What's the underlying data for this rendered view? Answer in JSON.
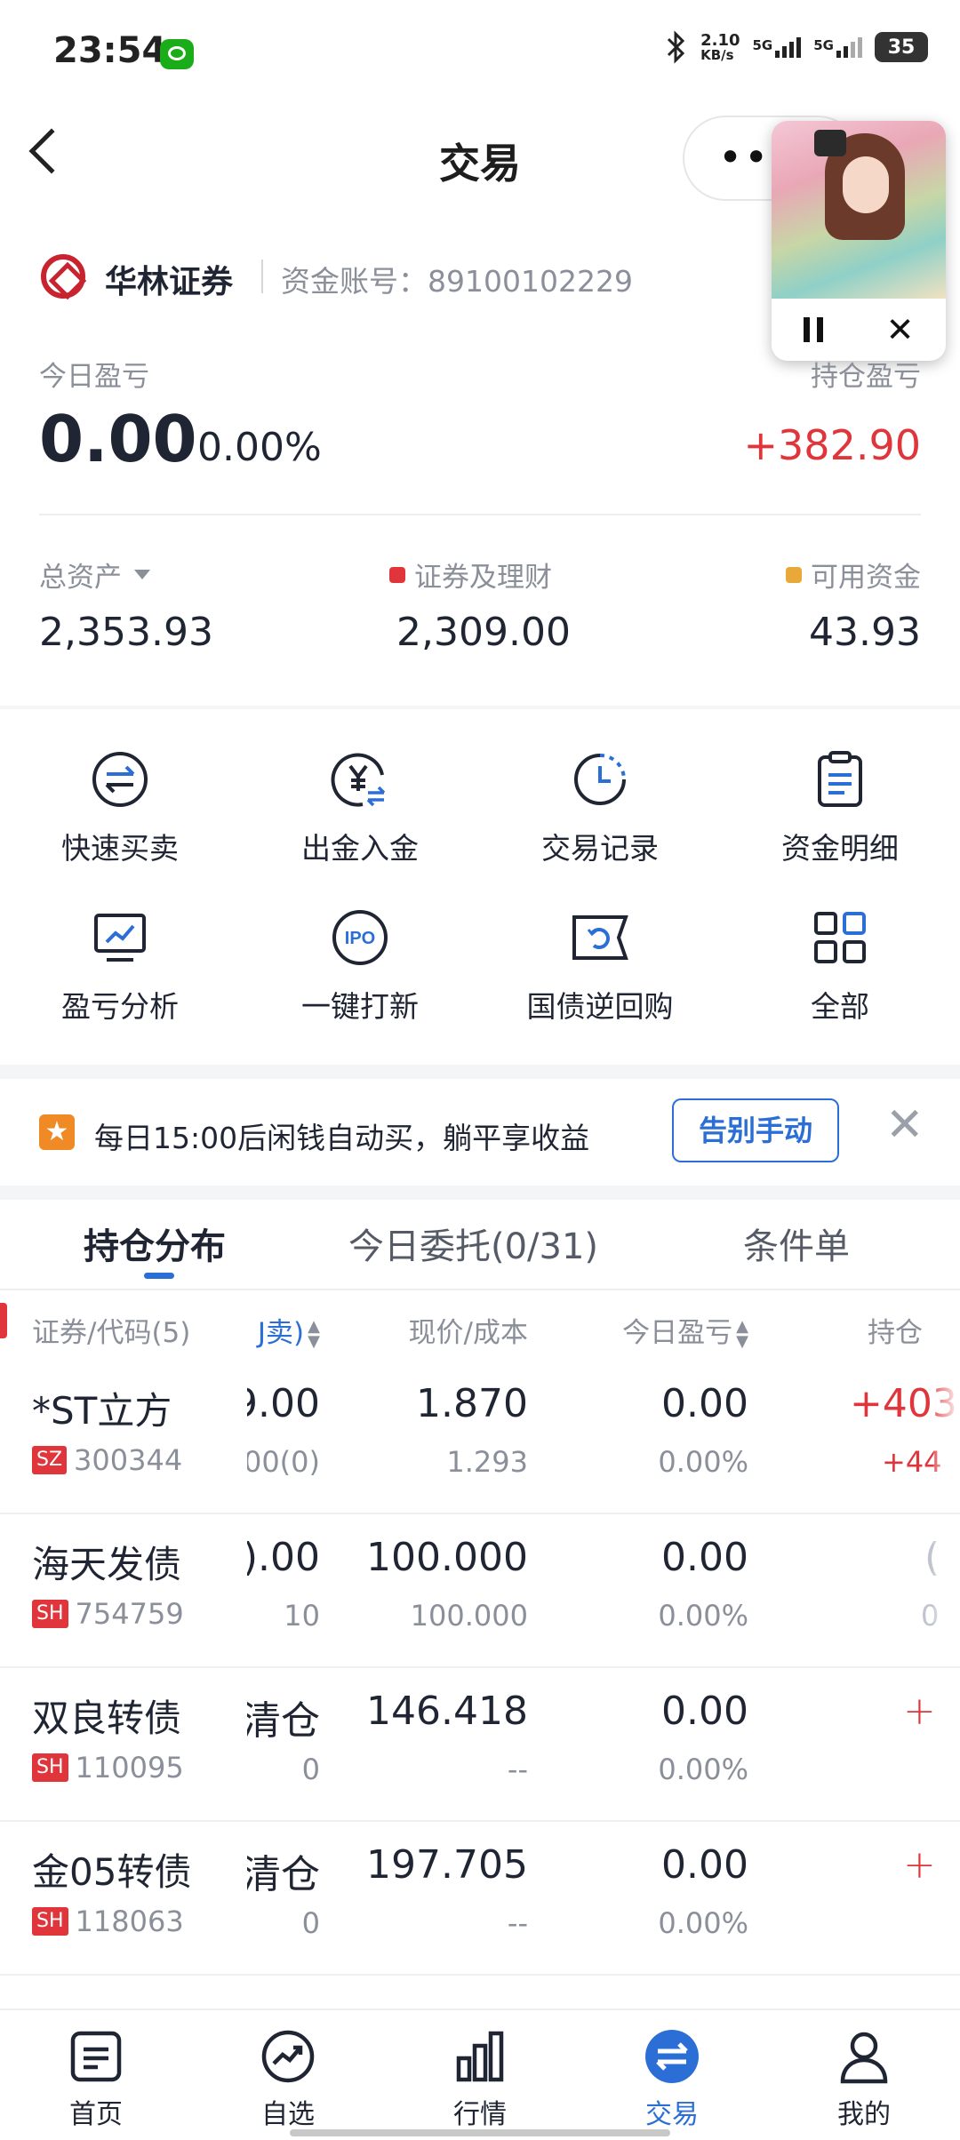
{
  "status_bar": {
    "time": "23:54",
    "net_speed": "2.10",
    "net_unit": "KB/s",
    "sig1": "5G",
    "sig2": "5G",
    "battery": "35"
  },
  "header": {
    "title": "交易"
  },
  "broker": {
    "name": "华林证券",
    "account": "资金账号：89100102229"
  },
  "pnl": {
    "today_label": "今日盈亏",
    "today_value": "0.00",
    "today_pct": "0.00%",
    "hold_label": "持仓盈亏",
    "hold_value": "+382.90"
  },
  "assets": {
    "total_label": "总资产",
    "total_value": "2,353.93",
    "securities_label": "证券及理财",
    "securities_value": "2,309.00",
    "available_label": "可用资金",
    "available_value": "43.93"
  },
  "quick_actions": [
    {
      "label": "快速买卖",
      "icon": "swap-icon"
    },
    {
      "label": "出金入金",
      "icon": "yuan-transfer-icon"
    },
    {
      "label": "交易记录",
      "icon": "clock-icon"
    },
    {
      "label": "资金明细",
      "icon": "clipboard-icon"
    },
    {
      "label": "盈亏分析",
      "icon": "chart-monitor-icon"
    },
    {
      "label": "一键打新",
      "icon": "ipo-icon"
    },
    {
      "label": "国债逆回购",
      "icon": "ticket-icon"
    },
    {
      "label": "全部",
      "icon": "grid-icon"
    }
  ],
  "promo": {
    "text": "每日15:00后闲钱自动买，躺平享收益",
    "button": "告别手动"
  },
  "tabs": [
    "持仓分布",
    "今日委托(0/31)",
    "条件单"
  ],
  "table": {
    "headers": [
      "证券/代码(5)",
      "J卖)",
      "现价/成本",
      "今日盈亏",
      "持仓"
    ],
    "rows": [
      {
        "name": "*ST立方",
        "market": "SZ",
        "code": "300344",
        "c1a": "9.00",
        "c1b": "00(0)",
        "c2a": "1.870",
        "c2b": "1.293",
        "c3a": "0.00",
        "c3b": "0.00%",
        "c4a": "+403",
        "c4b": "+44"
      },
      {
        "name": "海天发债",
        "market": "SH",
        "code": "754759",
        "c1a": ").00",
        "c1b": "10",
        "c2a": "100.000",
        "c2b": "100.000",
        "c3a": "0.00",
        "c3b": "0.00%",
        "c4a": "(",
        "c4b": "0"
      },
      {
        "name": "双良转债",
        "market": "SH",
        "code": "110095",
        "c1a": "清仓",
        "c1b": "0",
        "c2a": "146.418",
        "c2b": "--",
        "c3a": "0.00",
        "c3b": "0.00%",
        "c4a": "+",
        "c4b": ""
      },
      {
        "name": "金05转债",
        "market": "SH",
        "code": "118063",
        "c1a": "清仓",
        "c1b": "0",
        "c2a": "197.705",
        "c2b": "--",
        "c3a": "0.00",
        "c3b": "0.00%",
        "c4a": "+",
        "c4b": ""
      }
    ]
  },
  "bottom_nav": [
    {
      "label": "首页",
      "icon": "home-doc-icon"
    },
    {
      "label": "自选",
      "icon": "trend-icon"
    },
    {
      "label": "行情",
      "icon": "bar-chart-icon"
    },
    {
      "label": "交易",
      "icon": "exchange-icon"
    },
    {
      "label": "我的",
      "icon": "user-icon"
    }
  ],
  "colors": {
    "accent": "#2b6fd6",
    "up": "#e0353b",
    "securities_dot": "#e0353b",
    "available_dot": "#e8a93a"
  }
}
